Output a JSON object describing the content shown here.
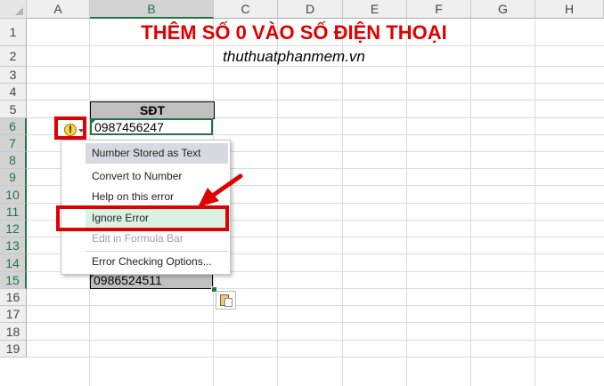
{
  "spreadsheet": {
    "columns": [
      "A",
      "B",
      "C",
      "D",
      "E",
      "F",
      "G",
      "H"
    ],
    "rows": [
      "1",
      "2",
      "3",
      "4",
      "5",
      "6",
      "7",
      "8",
      "9",
      "10",
      "11",
      "12",
      "13",
      "14",
      "15",
      "16",
      "17",
      "18",
      "19"
    ],
    "active_column": "B"
  },
  "content": {
    "title": "THÊM SỐ 0 VÀO SỐ ĐIỆN THOẠI",
    "subtitle": "thuthuatphanmem.vn",
    "header_cell": "SĐT",
    "cell_b6": "0987456247",
    "cell_b15": "0986524511"
  },
  "error_menu": {
    "heading": "Number Stored as Text",
    "items": [
      "Convert to Number",
      "Help on this error",
      "Ignore Error",
      "Edit in Formula Bar",
      "Error Checking Options..."
    ]
  },
  "icons": {
    "warning": "warning-icon",
    "warning_glyph": "!",
    "paste_options": "paste-options-icon"
  },
  "colors": {
    "title": "#e00000",
    "selection": "#217346",
    "annotation": "#e00000",
    "menu_highlight": "#d9f2e4"
  }
}
